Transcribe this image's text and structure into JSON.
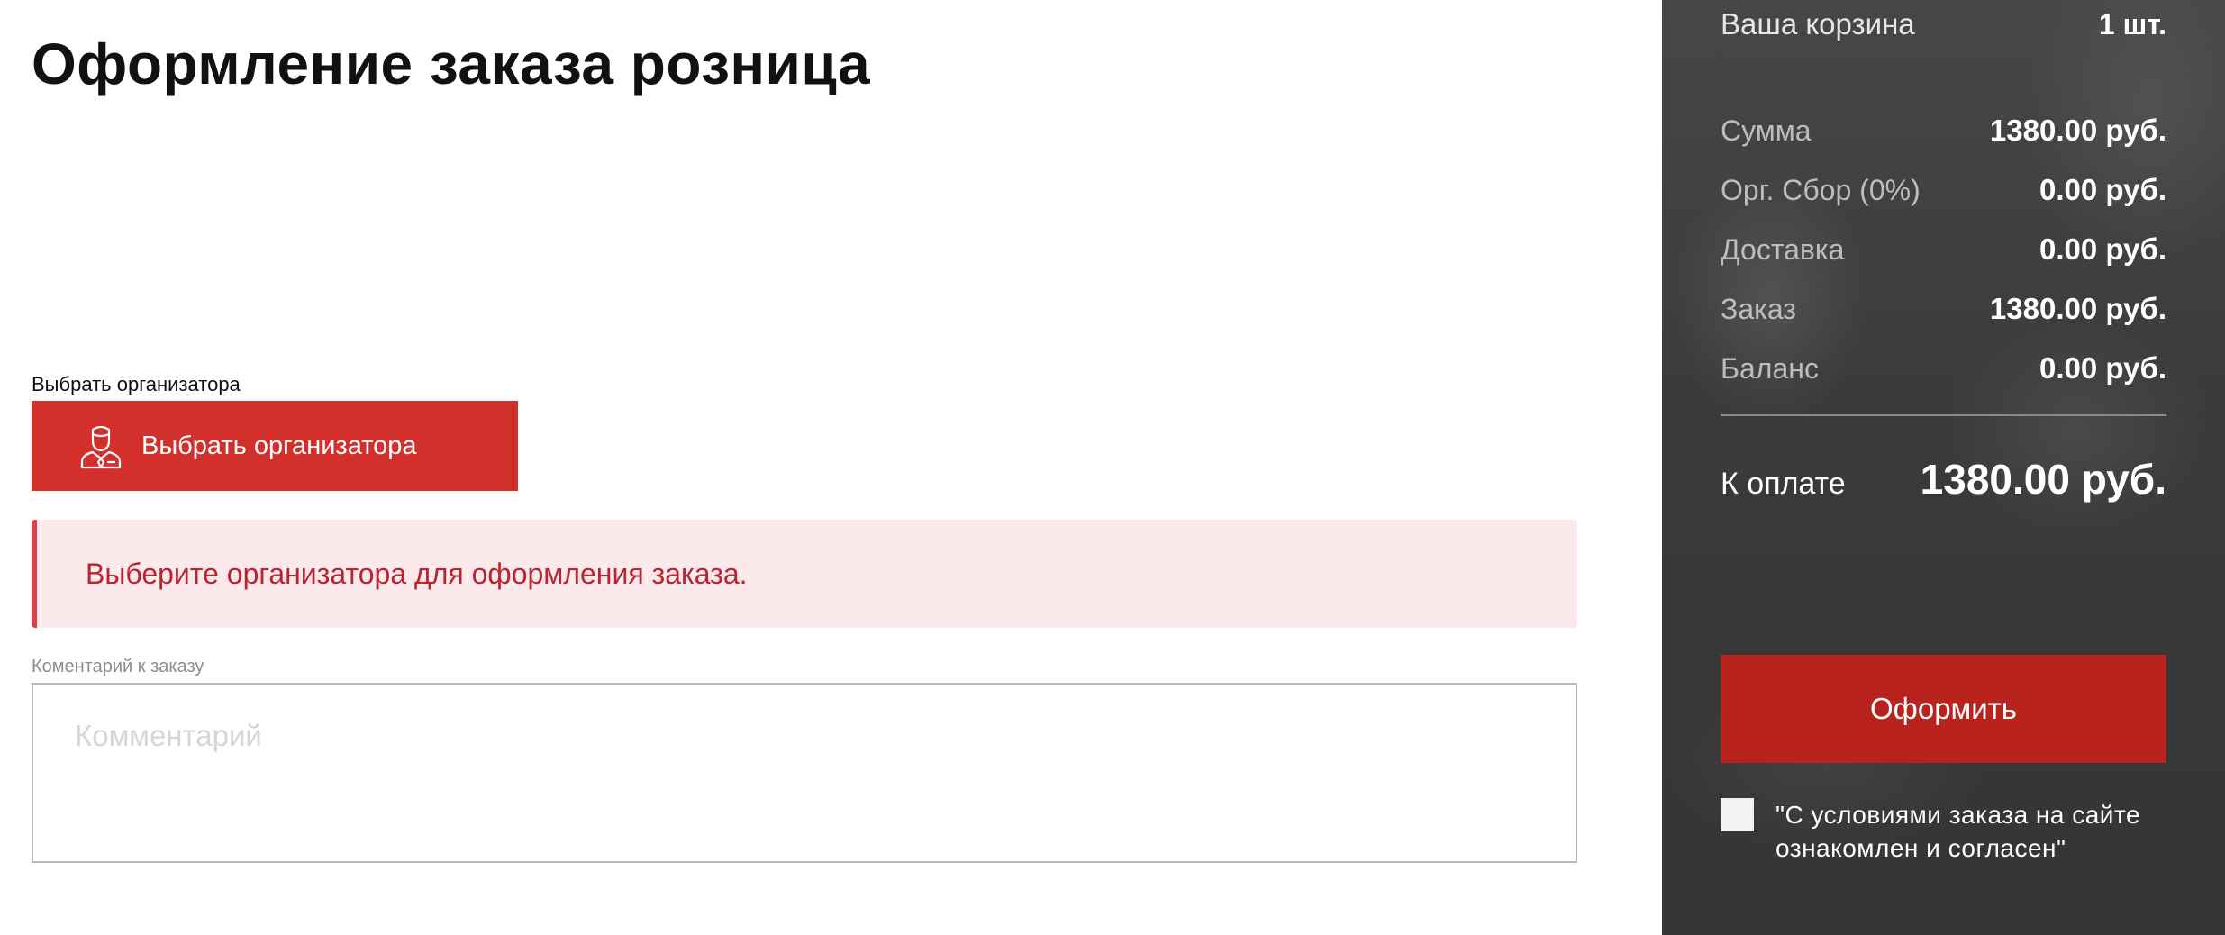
{
  "page": {
    "title": "Оформление заказа розница"
  },
  "organizer": {
    "label": "Выбрать организатора",
    "button_label": "Выбрать организатора",
    "button_icon": "user-tie-icon"
  },
  "alert": {
    "message": "Выберите организатора для оформления заказа."
  },
  "comment": {
    "label": "Коментарий к заказу",
    "placeholder": "Комментарий",
    "value": ""
  },
  "summary": {
    "cart_label": "Ваша корзина",
    "cart_count": "1 шт.",
    "rows": [
      {
        "label": "Сумма",
        "value": "1380.00 руб."
      },
      {
        "label": "Орг. Сбор (0%)",
        "value": "0.00 руб."
      },
      {
        "label": "Доставка",
        "value": "0.00 руб."
      },
      {
        "label": "Заказ",
        "value": "1380.00 руб."
      },
      {
        "label": "Баланс",
        "value": "0.00 руб."
      }
    ],
    "total_label": "К оплате",
    "total_value": "1380.00 руб.",
    "submit_label": "Оформить",
    "agree_text": "\"С условиями заказа на сайте ознакомлен и согласен\"",
    "agree_checked": false
  },
  "colors": {
    "accent_red": "#d3302b",
    "submit_red": "#b8231e",
    "alert_bg": "#fbe9ec",
    "alert_text": "#b8242f",
    "sidebar_bg": "#3c3c3c"
  }
}
